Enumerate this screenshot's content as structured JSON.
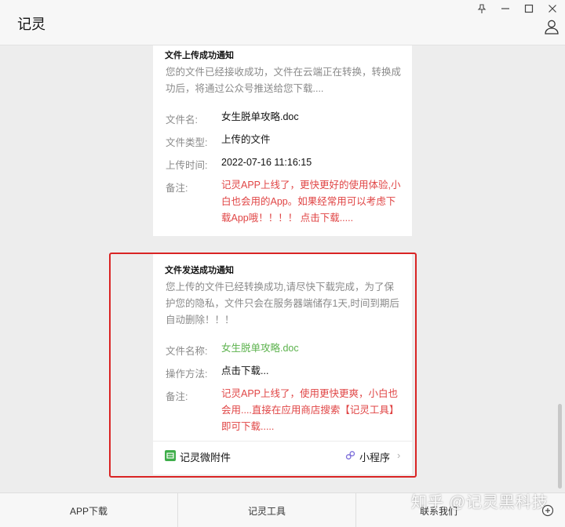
{
  "window": {
    "title": "记灵",
    "controls": {
      "pin": "pin-icon",
      "minimize": "minimize-icon",
      "maximize": "maximize-icon",
      "close": "close-icon"
    }
  },
  "messages": [
    {
      "title": "文件上传成功通知",
      "description": "您的文件已经接收成功，文件在云端正在转换，转换成功后，将通过公众号推送给您下载....",
      "fields": [
        {
          "label": "文件名:",
          "value": "女生脱单攻略.doc"
        },
        {
          "label": "文件类型:",
          "value": "上传的文件"
        },
        {
          "label": "上传时间:",
          "value": "2022-07-16 11:16:15"
        },
        {
          "label": "备注:",
          "value": "记灵APP上线了，更快更好的使用体验,小白也会用的App。如果经常用可以考虑下载App哦！！！！ 点击下载....."
        }
      ]
    },
    {
      "title": "文件发送成功通知",
      "description": "您上传的文件已经转换成功,请尽快下载完成，为了保护您的隐私，文件只会在服务器端储存1天,时间到期后自动删除！！！",
      "fields": [
        {
          "label": "文件名称:",
          "value": "女生脱单攻略.doc"
        },
        {
          "label": "操作方法:",
          "value": "点击下载..."
        },
        {
          "label": "备注:",
          "value": "记灵APP上线了，使用更快更爽，小白也会用....直接在应用商店搜索【记灵工具】即可下载....."
        }
      ],
      "footer": {
        "source": "记灵微附件",
        "mini_program": "小程序"
      }
    }
  ],
  "bottom_menu": [
    "APP下载",
    "记灵工具",
    "联系我们"
  ],
  "watermark": "知乎 @记灵黑科技",
  "colors": {
    "accent_red": "#e04545",
    "link_green": "#5bb24c",
    "highlight_border": "#d92424",
    "miniapp_green": "#3fae4a"
  }
}
